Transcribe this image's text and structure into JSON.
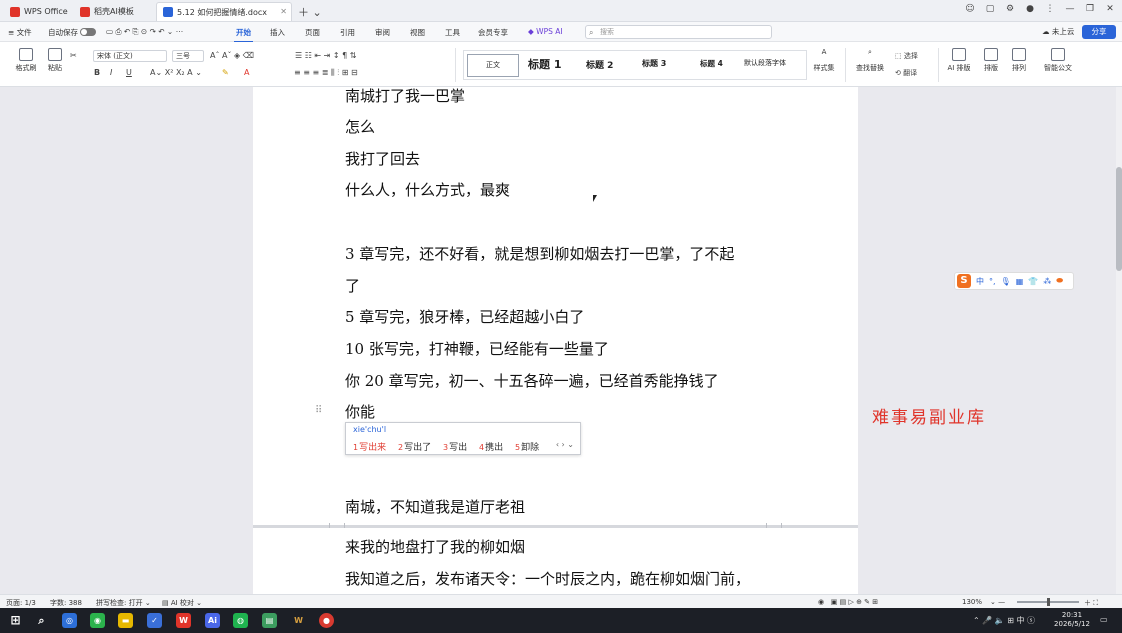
{
  "titlebar": {
    "tabs": [
      {
        "label": "WPS Office",
        "icon": "wps-logo-icon",
        "color": "#e0342a"
      },
      {
        "label": "稻壳AI模板",
        "icon": "docer-icon",
        "color": "#e0342a"
      },
      {
        "label": "5.12 如何把握情绪.docx",
        "icon": "word-doc-icon",
        "color": "#2a64d8"
      }
    ]
  },
  "menubar": {
    "file": "文件",
    "auto_save": "自动保存",
    "items": [
      "开始",
      "插入",
      "页面",
      "引用",
      "审阅",
      "视图",
      "工具",
      "会员专享"
    ],
    "active": "开始",
    "wps_ai": "WPS AI",
    "search_placeholder": "搜索",
    "cloud_status": "未上云",
    "share": "分享"
  },
  "ribbon": {
    "format_painter": "格式刷",
    "paste": "粘贴",
    "font_name": "宋体 (正文)",
    "font_size": "三号",
    "styles": [
      "正文",
      "标题 1",
      "标题 2",
      "标题 3",
      "标题 4",
      "默认段落字体"
    ],
    "style_set": "样式集",
    "find_replace": "查找替换",
    "select": "选择",
    "translate": "翻译",
    "ai_layout": "AI 排版",
    "layout": "排版",
    "arrange": "排列",
    "smart_doc": "智能公文"
  },
  "document": {
    "page1_lines": [
      "南城打了我一巴掌",
      "怎么",
      "我打了回去",
      "什么人，什么方式，最爽",
      "",
      "3 章写完，还不好看，就是想到柳如烟去打一巴掌，了不起",
      "了",
      "5 章写完，狼牙棒，已经超越小白了",
      "10 张写完，打神鞭，已经能有一些量了",
      "你 20 章写完，初一、十五各碎一遍，已经首秀能挣钱了",
      "你能"
    ],
    "after_ime_line": "南城，不知道我是道厅老祖",
    "page2_lines": [
      "来我的地盘打了我的柳如烟",
      "我知道之后，发布诸天令：一个时辰之内，跪在柳如烟门前，"
    ]
  },
  "ime": {
    "pinyin": "xie'chu'l",
    "candidates": [
      {
        "num": "1",
        "text": "写出来"
      },
      {
        "num": "2",
        "text": "写出了"
      },
      {
        "num": "3",
        "text": "写出"
      },
      {
        "num": "4",
        "text": "携出"
      },
      {
        "num": "5",
        "text": "卸除"
      }
    ],
    "nav": "‹ › ⌄"
  },
  "sogou_toolbar": {
    "mode": "中",
    "logo": "S"
  },
  "watermark": "难事易副业库",
  "statusbar": {
    "page": "页面: 1/3",
    "word_count": "字数: 388",
    "spell_check": "拼写检查: 打开",
    "ai_proofread": "AI 校对",
    "zoom": "130%"
  },
  "taskbar": {
    "time": "20:31",
    "date": "2026/5/12",
    "ime_mode": "中"
  },
  "colors": {
    "accent": "#2a64d8",
    "wps_red": "#e0342a",
    "page": "#ffffff",
    "canvas": "#e9e9ee"
  }
}
